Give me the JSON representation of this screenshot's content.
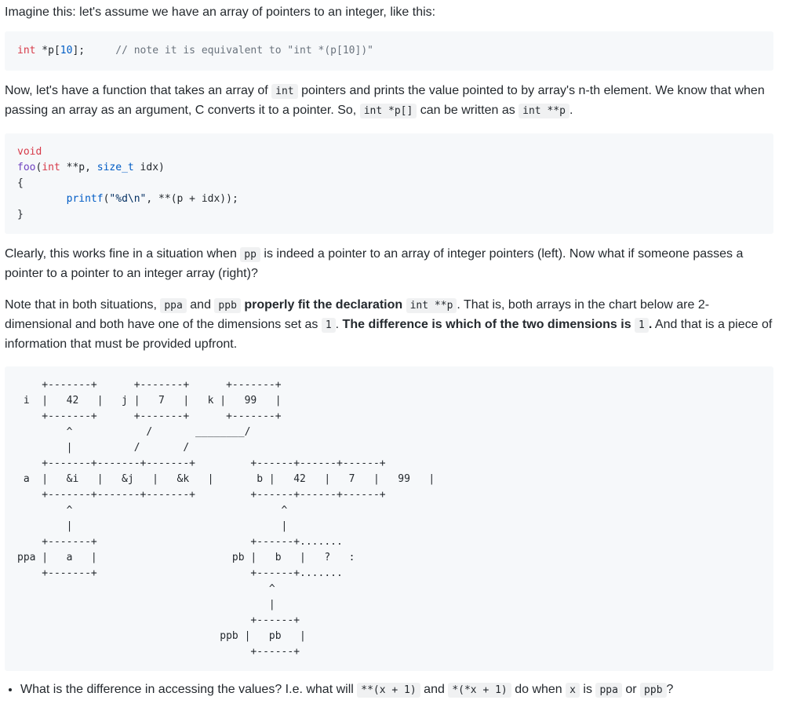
{
  "intro": "Imagine this: let's assume we have an array of pointers to an integer, like this:",
  "code1": {
    "type": "int",
    "decl_pre": " *p[",
    "size": "10",
    "decl_post": "];",
    "gap": "     ",
    "comment": "// note it is equivalent to \"int *(p[10])\""
  },
  "para2": {
    "t1": "Now, let's have a function that takes an array of ",
    "c1": "int",
    "t2": " pointers and prints the value pointed to by array's n-th element. We know that when passing an array as an argument, C converts it to a pointer. So, ",
    "c2": "int *p[]",
    "t3": " can be written as ",
    "c3": "int **p",
    "t4": "."
  },
  "code2": {
    "l1_kw": "void",
    "l2_fn": "foo",
    "l2_paren": "(",
    "l2_int": "int",
    "l2_mid": " **p, ",
    "l2_type": "size_t",
    "l2_end": " idx)",
    "l3": "{",
    "l4_indent": "        ",
    "l4_fn": "printf",
    "l4_open": "(",
    "l4_str": "\"%d\\n\"",
    "l4_rest": ", **(p + idx));",
    "l5": "}"
  },
  "para3": {
    "t1": "Clearly, this works fine in a situation when ",
    "c1": "pp",
    "t2": " is indeed a pointer to an array of integer pointers (left). Now what if someone passes a pointer to a pointer to an integer array (right)?"
  },
  "para4": {
    "t1": "Note that in both situations, ",
    "c1": "ppa",
    "t2": " and ",
    "c2": "ppb",
    "b1": " properly fit the declaration ",
    "c3": "int **p",
    "t3": ". That is, both arrays in the chart below are 2-dimensional and both have one of the dimensions set as ",
    "c4": "1",
    "t4": ". ",
    "b2": "The difference is which of the two dimensions is ",
    "c5": "1",
    "b3": ".",
    "t5": " And that is a piece of information that must be provided upfront."
  },
  "diagram": "    +-------+      +-------+      +-------+\n i  |   42   |   j |   7   |   k |   99   |\n    +-------+      +-------+      +-------+\n        ^            /       ________/\n        |          /       /\n    +-------+-------+-------+         +------+------+------+\n a  |   &i   |   &j   |   &k   |       b |   42   |   7   |   99   |\n    +-------+-------+-------+         +------+------+------+\n        ^                                  ^\n        |                                  |\n    +-------+                         +------+.......\nppa |   a   |                      pb |   b   |   ?   :\n    +-------+                         +------+.......\n                                         ^\n                                         |\n                                      +------+\n                                 ppb |   pb   |\n                                      +------+",
  "bullet": {
    "t1": "What is the difference in accessing the values? I.e. what will ",
    "c1": "**(x + 1)",
    "t2": " and ",
    "c2": "*(*x + 1)",
    "t3": " do when ",
    "c3": "x",
    "t4": " is ",
    "c4": "ppa",
    "t5": " or ",
    "c5": "ppb",
    "t6": "?"
  }
}
